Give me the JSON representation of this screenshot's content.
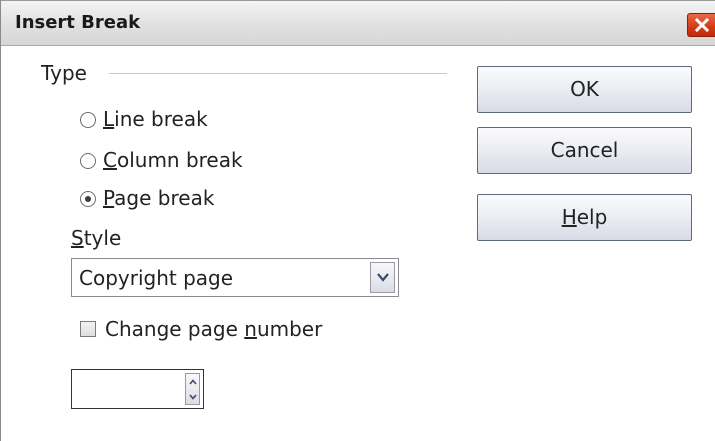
{
  "window": {
    "title": "Insert Break"
  },
  "type_group": {
    "label": "Type",
    "options": [
      {
        "prefix": "",
        "accel": "L",
        "suffix": "ine break",
        "selected": false
      },
      {
        "prefix": "",
        "accel": "C",
        "suffix": "olumn break",
        "selected": false
      },
      {
        "prefix": "",
        "accel": "P",
        "suffix": "age break",
        "selected": true
      }
    ]
  },
  "style": {
    "label_accel": "S",
    "label_rest": "tyle",
    "selected_value": "Copyright page"
  },
  "change_page_number": {
    "label_prefix": "Change page ",
    "label_accel": "n",
    "label_suffix": "umber",
    "checked": false,
    "value": ""
  },
  "buttons": {
    "ok": "OK",
    "cancel": "Cancel",
    "help_accel": "H",
    "help_rest": "elp"
  },
  "icons": {
    "close": "close-icon",
    "dropdown": "chevron-down-icon",
    "spin_up": "chevron-up-icon",
    "spin_down": "chevron-down-icon"
  },
  "colors": {
    "close_button": "#d23a17",
    "button_border": "#5e6a84"
  }
}
